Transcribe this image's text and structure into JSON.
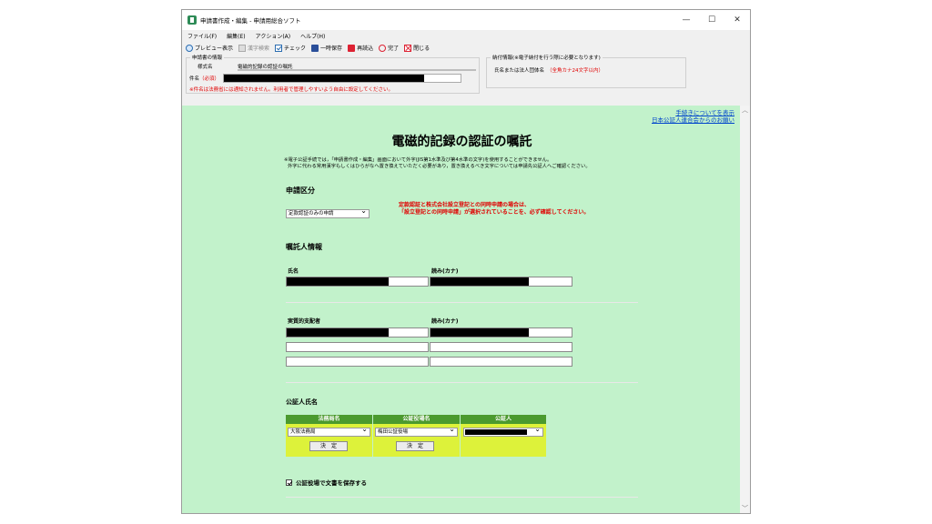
{
  "window": {
    "title": "申請書作成・編集 - 申請用総合ソフト",
    "min": "—",
    "max": "☐",
    "close": "✕"
  },
  "menu": [
    "ファイル(F)",
    "編集(E)",
    "アクション(A)",
    "ヘルプ(H)"
  ],
  "toolbar": {
    "preview": "プレビュー表示",
    "kanji": "漢字検索",
    "check": "チェック",
    "save": "一時保存",
    "reload": "再読込",
    "done": "完了",
    "close": "閉じる"
  },
  "applicant": {
    "group_title": "申請書の情報",
    "form_label": "様式名",
    "form_value": "電磁的記録の認証の嘱託",
    "subject_label": "件名",
    "subject_required": "（必須）",
    "note": "※件名は法務省には通知されません。利用者で管理しやすいよう自由に設定してください。"
  },
  "payment": {
    "group_title": "納付情報(※電子納付を行う際に必要となります)",
    "label": "氏名または法人団体名",
    "hint": "（全角カナ24文字以内）"
  },
  "links": [
    "手続きについてを表示",
    "日本公証人連合会からのお願い"
  ],
  "page": {
    "title": "電磁的記録の認証の嘱託",
    "note1": "※電子公証手続では，「申請書作成・編集」画面において外字(JIS第1水準及び第4水準の文字)を使用することができません。",
    "note2": "外字に代わる常用漢字もしくはひらがなへ置き換えていただく必要があり，置き換えるべき文字については申請先公証人へご確認ください。"
  },
  "request": {
    "section": "申請区分",
    "select": "定款認証のみの申請",
    "warn1": "定款認証と株式会社設立登記との同時申請の場合は、",
    "warn2": "「設立登記との同時申請」が選択されていることを、必ず確認してください。"
  },
  "principal": {
    "section": "嘱託人情報",
    "name_label": "氏名",
    "kana_label": "読み(カナ)",
    "controller_label": "実質的支配者",
    "controller_kana_label": "読み(カナ)"
  },
  "notary": {
    "section": "公証人氏名",
    "headers": [
      "法務局名",
      "公証役場名",
      "公証人"
    ],
    "bureau": "大阪法務局",
    "office": "梅田公証役場",
    "decide": "決　定"
  },
  "save_option": "公証役場で文書を保存する",
  "colors": {
    "content_bg": "#c2f2cb",
    "header_green": "#4b9a2e",
    "cell_yellow": "#ddf23a",
    "warn_red": "#e00000",
    "link_blue": "#0044cc"
  }
}
